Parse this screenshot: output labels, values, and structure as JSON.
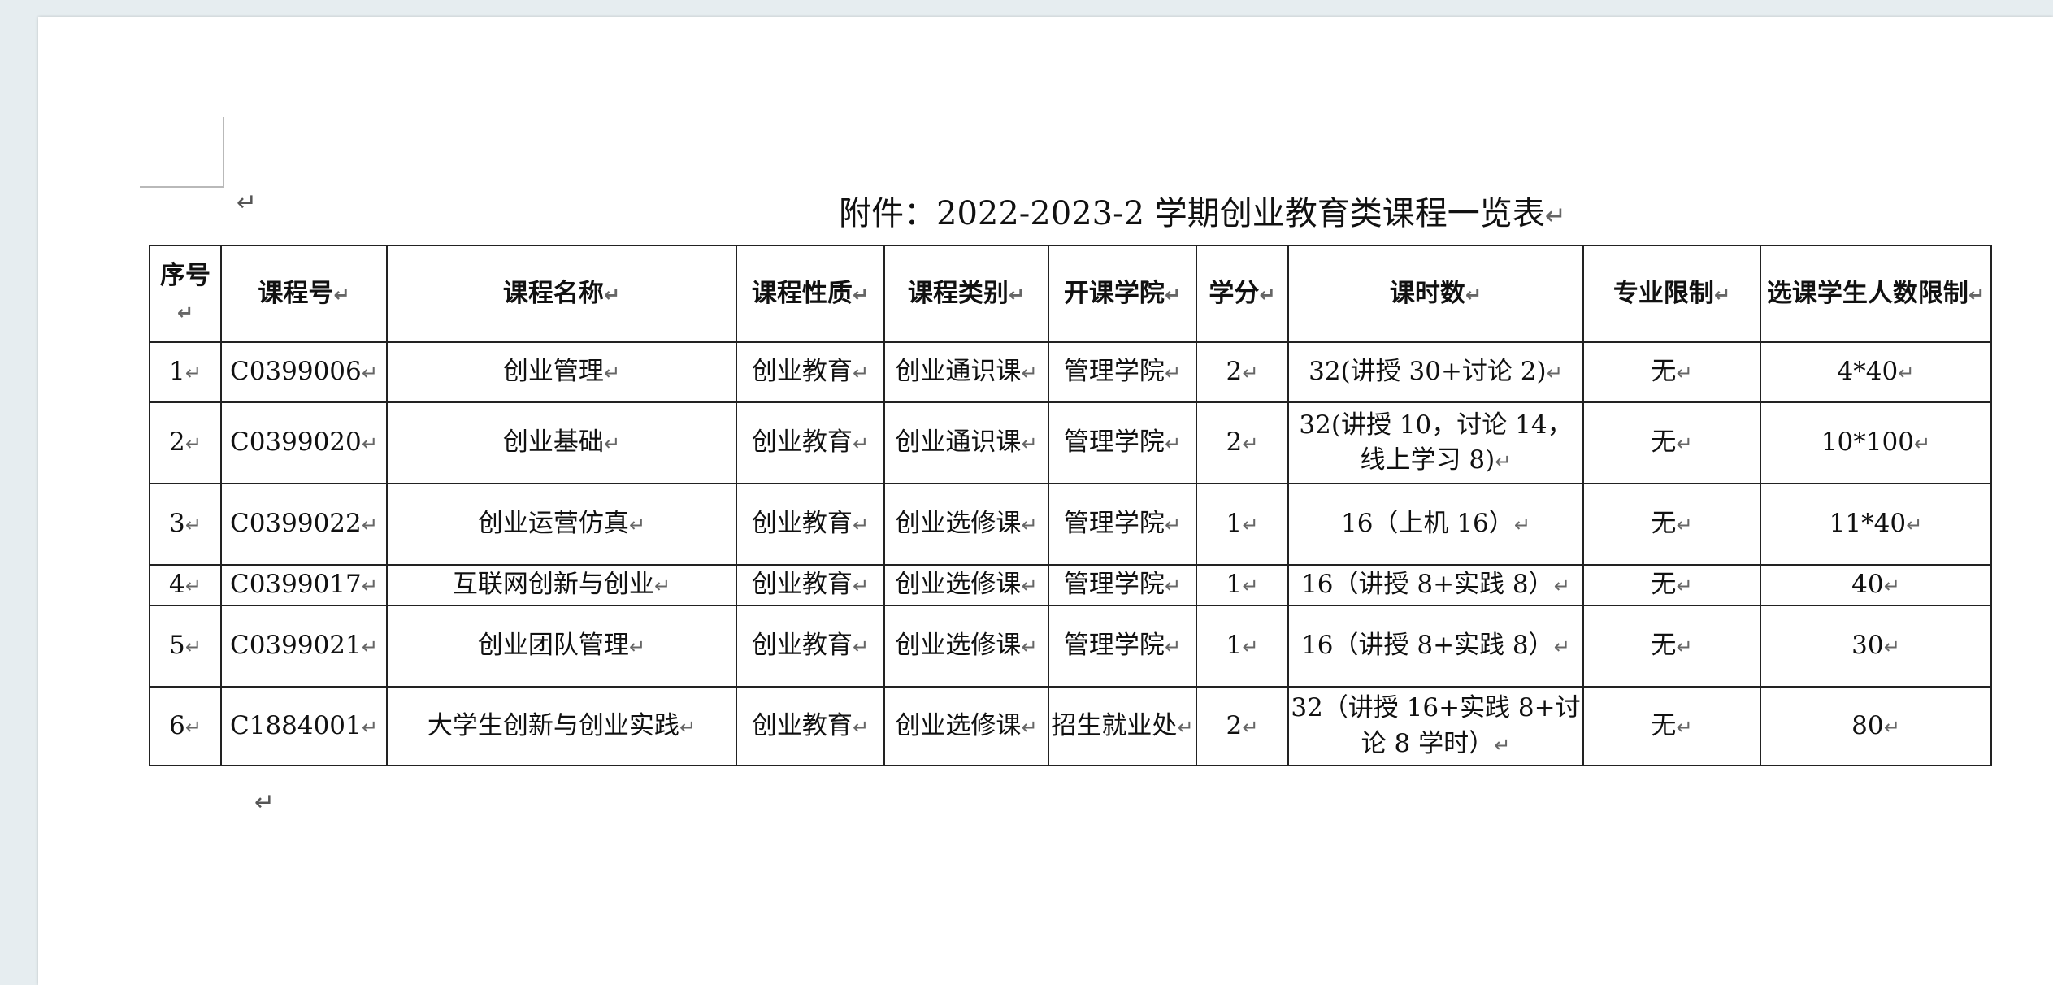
{
  "document": {
    "title": "附件：2022-2023-2 学期创业教育类课程一览表",
    "paragraph_mark": "↵"
  },
  "table": {
    "headers": [
      "序号",
      "课程号",
      "课程名称",
      "课程性质",
      "课程类别",
      "开课学院",
      "学分",
      "课时数",
      "专业限制",
      "选课学生人数限制"
    ],
    "rows": [
      {
        "no": "1",
        "code": "C0399006",
        "name": "创业管理",
        "nature": "创业教育",
        "category": "创业通识课",
        "college": "管理学院",
        "credit": "2",
        "hours": "32(讲授 30+讨论 2)",
        "major_limit": "无",
        "student_limit": "4*40"
      },
      {
        "no": "2",
        "code": "C0399020",
        "name": "创业基础",
        "nature": "创业教育",
        "category": "创业通识课",
        "college": "管理学院",
        "credit": "2",
        "hours": "32(讲授 10，讨论 14，线上学习 8)",
        "major_limit": "无",
        "student_limit": "10*100"
      },
      {
        "no": "3",
        "code": "C0399022",
        "name": "创业运营仿真",
        "nature": "创业教育",
        "category": "创业选修课",
        "college": "管理学院",
        "credit": "1",
        "hours": "16（上机 16）",
        "major_limit": "无",
        "student_limit": "11*40"
      },
      {
        "no": "4",
        "code": "C0399017",
        "name": "互联网创新与创业",
        "nature": "创业教育",
        "category": "创业选修课",
        "college": "管理学院",
        "credit": "1",
        "hours": "16（讲授 8+实践 8）",
        "major_limit": "无",
        "student_limit": "40"
      },
      {
        "no": "5",
        "code": "C0399021",
        "name": "创业团队管理",
        "nature": "创业教育",
        "category": "创业选修课",
        "college": "管理学院",
        "credit": "1",
        "hours": "16（讲授 8+实践 8）",
        "major_limit": "无",
        "student_limit": "30"
      },
      {
        "no": "6",
        "code": "C1884001",
        "name": "大学生创新与创业实践",
        "nature": "创业教育",
        "category": "创业选修课",
        "college": "招生就业处",
        "credit": "2",
        "hours": "32（讲授 16+实践 8+讨论 8 学时）",
        "major_limit": "无",
        "student_limit": "80"
      }
    ]
  }
}
